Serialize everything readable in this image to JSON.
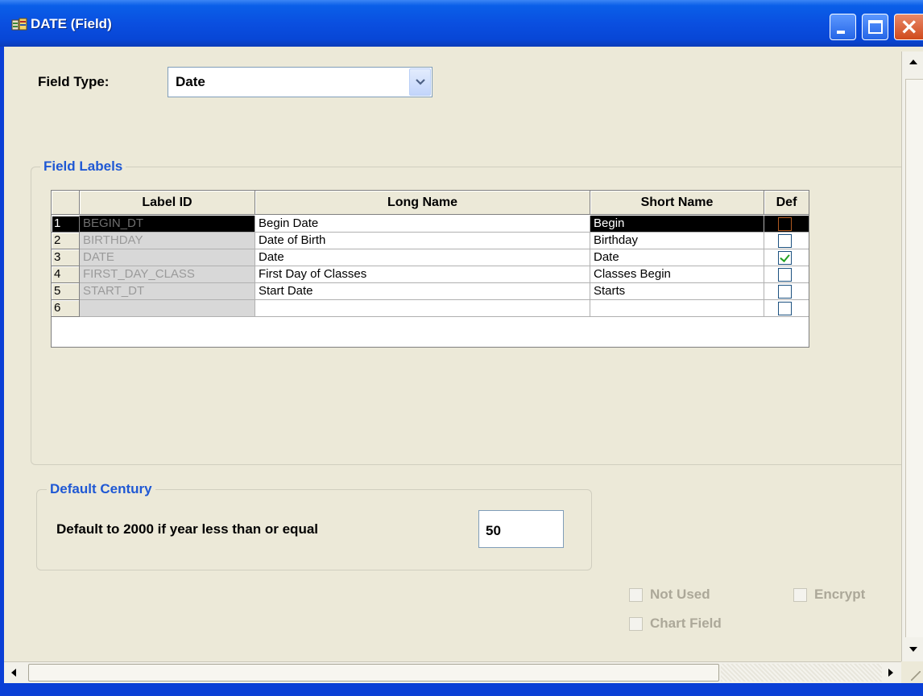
{
  "window": {
    "title": "DATE (Field)",
    "icons": {
      "app": "field-definition-icon",
      "minimize": "minimize-icon",
      "maximize": "maximize-icon",
      "close": "close-icon"
    }
  },
  "field_type": {
    "label": "Field Type:",
    "value": "Date"
  },
  "field_labels": {
    "legend": "Field Labels",
    "columns": [
      "Label ID",
      "Long Name",
      "Short Name",
      "Def"
    ],
    "rows": [
      {
        "num": "1",
        "label_id": "BEGIN_DT",
        "long_name": "Begin Date",
        "short_name": "Begin",
        "default": false,
        "selected": true
      },
      {
        "num": "2",
        "label_id": "BIRTHDAY",
        "long_name": "Date of Birth",
        "short_name": "Birthday",
        "default": false,
        "selected": false
      },
      {
        "num": "3",
        "label_id": "DATE",
        "long_name": "Date",
        "short_name": "Date",
        "default": true,
        "selected": false
      },
      {
        "num": "4",
        "label_id": "FIRST_DAY_CLASS",
        "long_name": "First Day of Classes",
        "short_name": "Classes Begin",
        "default": false,
        "selected": false
      },
      {
        "num": "5",
        "label_id": "START_DT",
        "long_name": "Start Date",
        "short_name": "Starts",
        "default": false,
        "selected": false
      },
      {
        "num": "6",
        "label_id": "",
        "long_name": "",
        "short_name": "",
        "default": false,
        "selected": false
      }
    ]
  },
  "default_century": {
    "legend": "Default Century",
    "label": "Default to 2000 if year less than or equal",
    "value": "50"
  },
  "options": {
    "not_used": "Not Used",
    "encrypt": "Encrypt",
    "chart_field": "Chart Field"
  }
}
